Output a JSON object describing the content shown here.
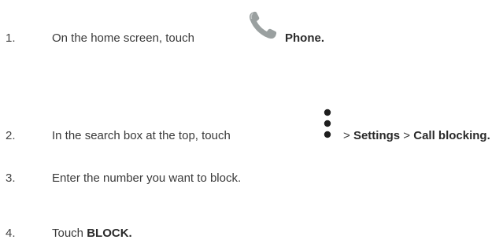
{
  "steps": [
    {
      "number": "1.",
      "text": "On the home screen, touch",
      "icon": "phone-icon",
      "trail_bold": "Phone."
    },
    {
      "number": "2.",
      "text": "In the search box at the top, touch",
      "icon": "more-vert-icon",
      "sep1": ">",
      "settings": "Settings",
      "sep2": ">",
      "call_blocking": "Call blocking."
    },
    {
      "number": "3.",
      "text": "Enter the number you want to block."
    },
    {
      "number": "4.",
      "text_prefix": "Touch",
      "bold_label": "BLOCK."
    }
  ],
  "colors": {
    "text": "#3a3a3a",
    "phone_icon": "#9aa0a0",
    "menu_dots": "#1e1e1e"
  }
}
